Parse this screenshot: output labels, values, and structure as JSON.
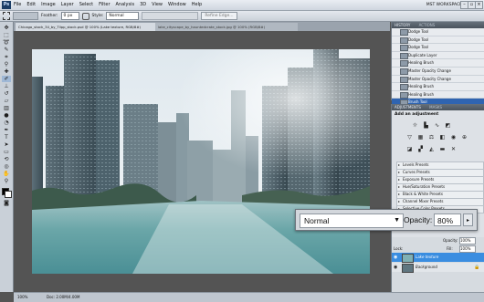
{
  "app": {
    "logo": "Ps",
    "menus": [
      "File",
      "Edit",
      "Image",
      "Layer",
      "Select",
      "Filter",
      "Analysis",
      "3D",
      "View",
      "Window",
      "Help"
    ],
    "workspace": "MST WORKSPACE",
    "window_buttons": [
      "–",
      "▫",
      "×"
    ]
  },
  "options_bar": {
    "feather_label": "Feather:",
    "feather_value": "0 px",
    "style_label": "Style:",
    "style_value": "Normal",
    "refine_edge": "Refine Edge..."
  },
  "tabs": [
    {
      "label": "Chicago_stock_34_by_Tilpp_stock.psd @ 100% (Lake texture, RGB/8#)",
      "active": true
    },
    {
      "label": "lake_cityscape_by_hauntedcrate_stock.jpg @ 100% (RGB/8#)",
      "active": false
    }
  ],
  "history": {
    "tabs": [
      "HISTORY",
      "ACTIONS"
    ],
    "items": [
      "Dodge Tool",
      "Dodge Tool",
      "Dodge Tool",
      "Duplicate Layer",
      "Healing Brush",
      "Master Opacity Change",
      "Master Opacity Change",
      "Healing Brush",
      "Healing Brush",
      "Brush Tool"
    ],
    "active_index": 9
  },
  "adjustments": {
    "tabs": [
      "ADJUSTMENTS",
      "MASKS"
    ],
    "subtitle": "Add an adjustment",
    "presets": [
      "Levels Presets",
      "Curves Presets",
      "Exposure Presets",
      "Hue/Saturation Presets",
      "Black & White Presets",
      "Channel Mixer Presets",
      "Selective Color Presets"
    ]
  },
  "layers": {
    "opacity_label": "Opacity:",
    "opacity_value": "100%",
    "lock_label": "Lock:",
    "fill_label": "Fill:",
    "fill_value": "100%",
    "items": [
      {
        "name": "Lake texture",
        "selected": true
      },
      {
        "name": "Background",
        "selected": false
      }
    ]
  },
  "overlay": {
    "blend_mode": "Normal",
    "opacity_label": "Opacity:",
    "opacity_value": "80%"
  },
  "status": {
    "zoom": "100%",
    "doc": "Doc: 2.00M/4.00M"
  },
  "colors": {
    "selection_blue": "#2f64b1",
    "panel_header": "#4a535d",
    "background": "#545454"
  }
}
